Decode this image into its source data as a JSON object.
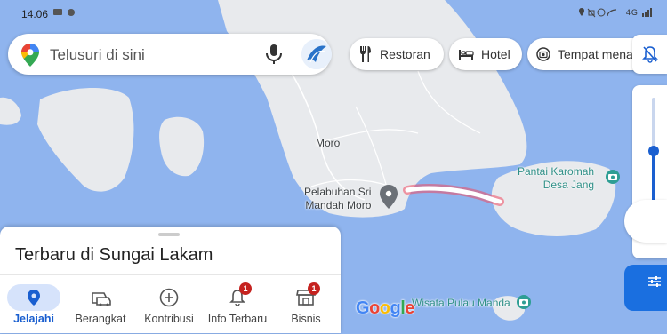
{
  "status": {
    "time": "14.06",
    "network": "4G"
  },
  "search": {
    "placeholder": "Telusuri di sini"
  },
  "chips": [
    {
      "label": "Restoran",
      "icon": "fork-knife-icon"
    },
    {
      "label": "Hotel",
      "icon": "bed-icon"
    },
    {
      "label": "Tempat menarik",
      "icon": "camera-icon"
    }
  ],
  "map": {
    "places": {
      "moro": "Moro",
      "harbor": "Pelabuhan Sri Mandah Moro",
      "harbor_line1": "Pelabuhan Sri",
      "harbor_line2": "Mandah Moro",
      "pantai_line1": "Pantai Karomah",
      "pantai_line2": "Desa Jang",
      "wisata": "Wisata Pulau Manda"
    },
    "attribution": "Google",
    "colors": {
      "water": "#8fb4ee",
      "land": "#e8eaed",
      "route_highlight": "#f04a63"
    }
  },
  "sheet": {
    "title": "Terbaru di Sungai Lakam"
  },
  "nav": [
    {
      "label": "Jelajahi",
      "icon": "location-pin-icon",
      "active": true
    },
    {
      "label": "Berangkat",
      "icon": "car-icon",
      "active": false
    },
    {
      "label": "Kontribusi",
      "icon": "add-circle-icon",
      "active": false
    },
    {
      "label": "Info Terbaru",
      "icon": "bell-icon",
      "badge": "1",
      "active": false
    },
    {
      "label": "Bisnis",
      "icon": "store-icon",
      "badge": "1",
      "active": false
    }
  ]
}
